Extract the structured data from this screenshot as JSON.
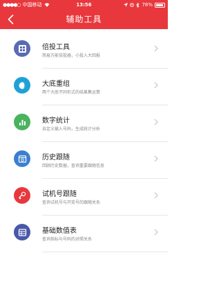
{
  "status_bar": {
    "carrier": "中国移动",
    "time": "13:56",
    "battery": "78%"
  },
  "nav": {
    "title": "辅助工具"
  },
  "tools": [
    {
      "title": "倍投工具",
      "subtitle": "简易万能倍投器，小投入大回报",
      "icon": "calculator-icon",
      "color": "#5a6bb4"
    },
    {
      "title": "大底重组",
      "subtitle": "两个大底不同形式的结果集运算",
      "icon": "merge-circles-icon",
      "color": "#1fa1d8"
    },
    {
      "title": "数字统计",
      "subtitle": "自定义输入号码，生成统计分析",
      "icon": "bar-chart-icon",
      "color": "#4bb25f"
    },
    {
      "title": "历史跟随",
      "subtitle": "回顾历史数据，查询重要跟随信息",
      "icon": "history-window-icon",
      "color": "#3c7fd0"
    },
    {
      "title": "试机号跟随",
      "subtitle": "查询试机号与开奖号的跟随关系",
      "icon": "test-number-icon",
      "color": "#e8383d"
    },
    {
      "title": "基础数值表",
      "subtitle": "查询指标与号码的对照关系",
      "icon": "table-icon",
      "color": "#4a58a8"
    }
  ]
}
